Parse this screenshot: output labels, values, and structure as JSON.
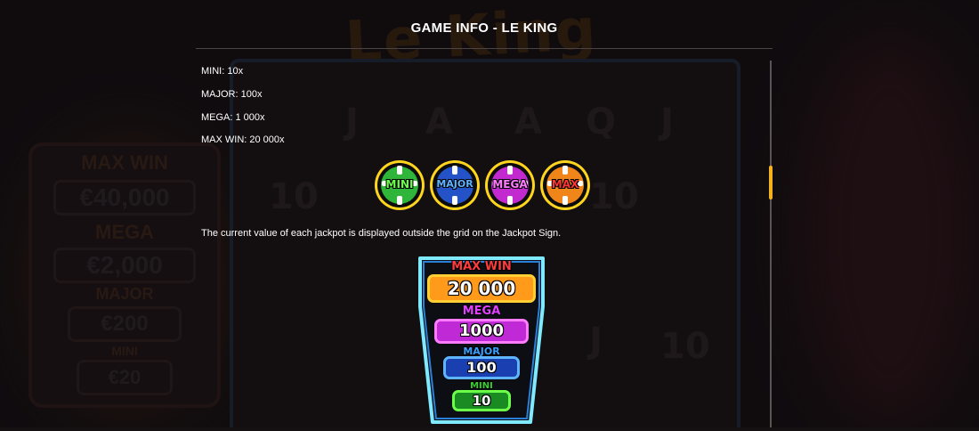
{
  "modal": {
    "title": "GAME INFO - LE KING"
  },
  "jackpots": [
    {
      "label": "MINI: 10x"
    },
    {
      "label": "MAJOR: 100x"
    },
    {
      "label": "MEGA: 1 000x"
    },
    {
      "label": "MAX WIN: 20 000x"
    }
  ],
  "chips": [
    {
      "label": "MINI",
      "color": "#2fb63a",
      "text_color": "#6bff4a"
    },
    {
      "label": "MAJOR",
      "color": "#2453c8",
      "text_color": "#5fb4ff"
    },
    {
      "label": "MEGA",
      "color": "#c22ad0",
      "text_color": "#ff7cff"
    },
    {
      "label": "MAX",
      "color": "#f0861a",
      "text_color": "#ff3535"
    }
  ],
  "description": "The current value of each jackpot is displayed outside the grid on the Jackpot Sign.",
  "jackpot_sign": {
    "max_win_label": "MAX WIN",
    "max_win_value": "20 000",
    "mega_label": "MEGA",
    "mega_value": "1000",
    "major_label": "MAJOR",
    "major_value": "100",
    "mini_label": "MINI",
    "mini_value": "10"
  },
  "background": {
    "game_title": "Le King",
    "sign_labels": [
      "MAX WIN",
      "MEGA",
      "MAJOR",
      "MINI"
    ],
    "sign_values": [
      "€40,000",
      "€2,000",
      "€200",
      "€20"
    ],
    "reel_symbols": [
      "J",
      "J",
      "A",
      "A",
      "Q",
      "J",
      "10",
      "10",
      "J",
      "10",
      "10"
    ]
  },
  "scrollbar": {
    "position": 0.28
  },
  "colors": {
    "accent": "#f5b21b",
    "max_win": "#ff3b3b",
    "mega": "#e040ff",
    "major": "#3aa0ff",
    "mini": "#34d02c"
  }
}
